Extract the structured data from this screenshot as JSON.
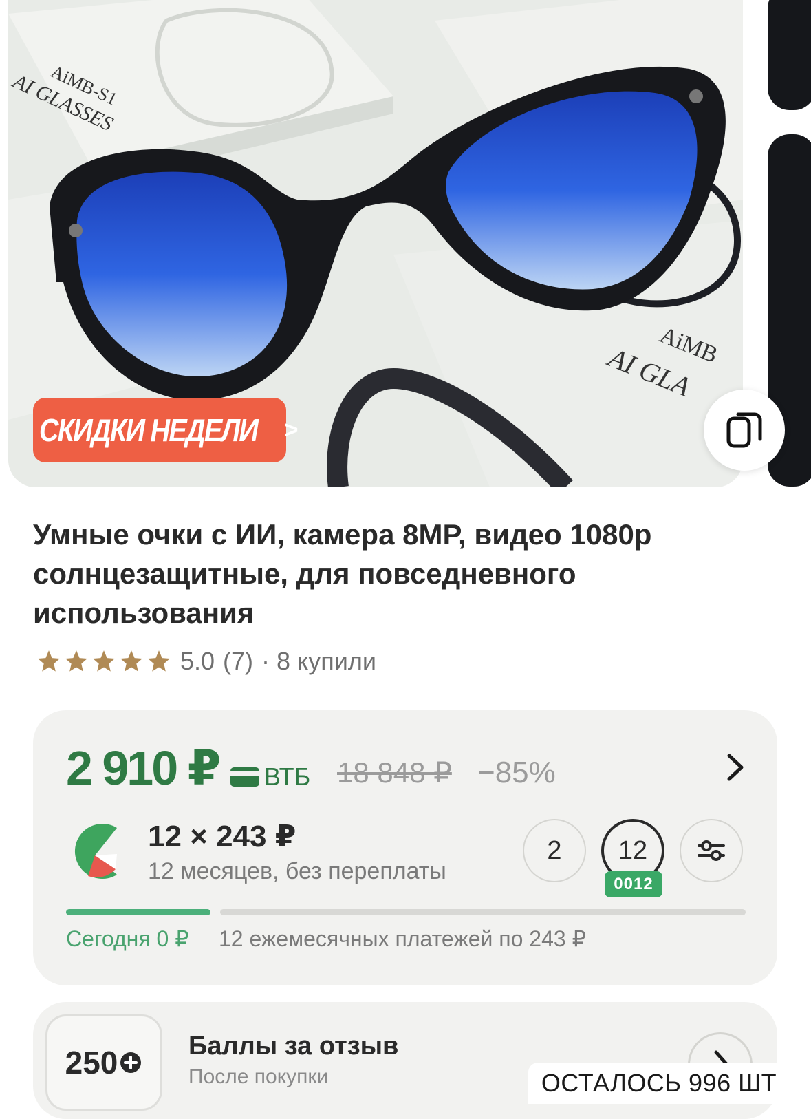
{
  "gallery": {
    "promo_label": "СКИДКИ НЕДЕЛИ",
    "promo_chevron": ">",
    "box_text_1": "AiMB-S1",
    "box_text_2": "AI GLASSES",
    "box_text_3": "AiMB",
    "box_text_4": "AI GLA",
    "photo_colors": {
      "lens": "#2d5bd9",
      "frame": "#1a1a1d",
      "promo": "#ee5f44"
    }
  },
  "product": {
    "title": "Умные очки с ИИ, камера 8MP, видео 1080p солнцезащитные, для повседневного использования",
    "rating": "5.0",
    "reviews": "(7)",
    "bought": "· 8 купили",
    "stars": 5,
    "star_color": "#b08a55"
  },
  "price": {
    "current": "2 910 ₽",
    "bank": "ВТБ",
    "old": "18 848 ₽",
    "discount": "−85%",
    "accent": "#2f7a44"
  },
  "installment": {
    "amount": "12 × 243 ₽",
    "subtitle": "12 месяцев, без переплаты",
    "terms": [
      "2",
      "12"
    ],
    "active_term_badge": "0012",
    "today": "Сегодня 0 ₽",
    "monthly": "12 ежемесячных платежей по 243 ₽"
  },
  "bonus": {
    "points": "250",
    "title": "Баллы за отзыв",
    "subtitle": "После покупки"
  },
  "stock": {
    "label": "ОСТАЛОСЬ 996 ШТ"
  }
}
